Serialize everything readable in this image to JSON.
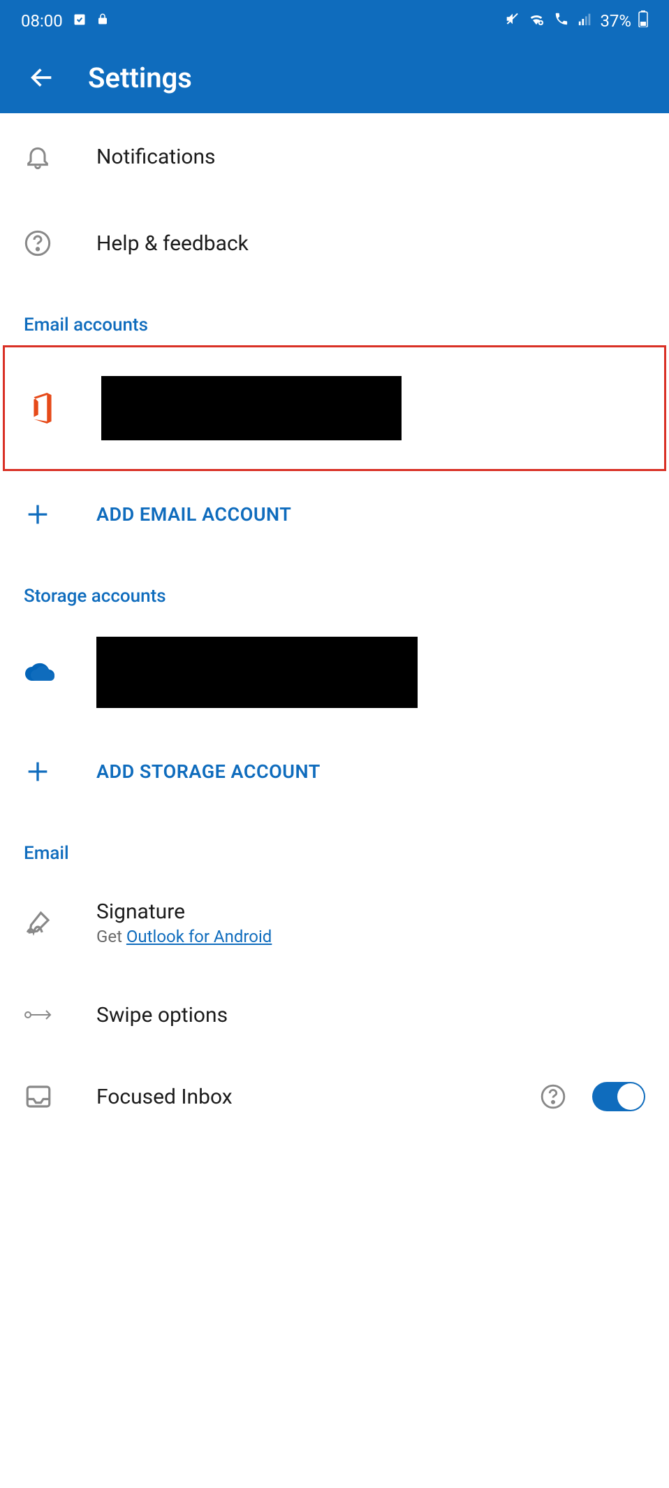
{
  "statusBar": {
    "time": "08:00",
    "battery": "37%"
  },
  "appBar": {
    "title": "Settings"
  },
  "items": {
    "notifications": "Notifications",
    "helpFeedback": "Help & feedback"
  },
  "sections": {
    "emailAccounts": "Email accounts",
    "storageAccounts": "Storage accounts",
    "email": "Email"
  },
  "actions": {
    "addEmail": "ADD EMAIL ACCOUNT",
    "addStorage": "ADD STORAGE ACCOUNT"
  },
  "signature": {
    "label": "Signature",
    "subPrefix": "Get ",
    "subLink": "Outlook for Android"
  },
  "swipeOptions": "Swipe options",
  "focusedInbox": "Focused Inbox"
}
